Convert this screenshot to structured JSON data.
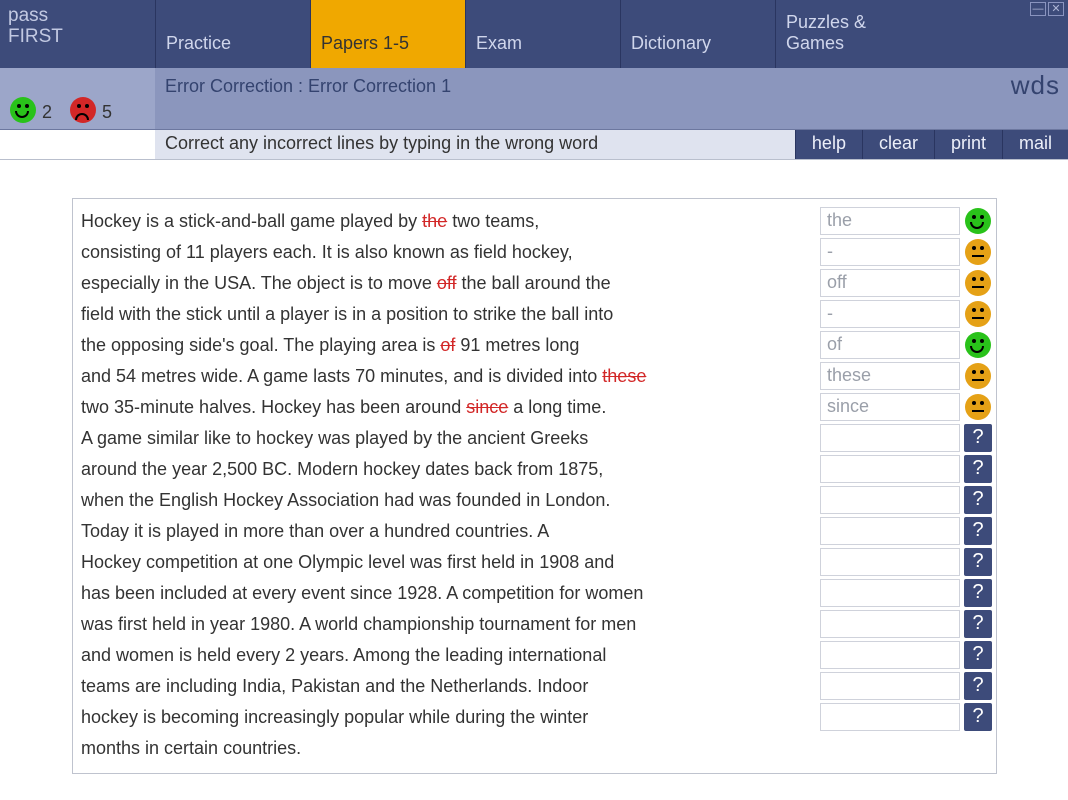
{
  "logo": {
    "line1": "pass",
    "line2": "FIRST"
  },
  "nav": {
    "tabs": [
      {
        "label": "Practice",
        "active": false
      },
      {
        "label": "Papers 1-5",
        "active": true
      },
      {
        "label": "Exam",
        "active": false
      },
      {
        "label": "Dictionary",
        "active": false
      },
      {
        "label": "Puzzles & Games",
        "active": false
      }
    ]
  },
  "brand": "wds",
  "subtitle": "Error Correction : Error Correction 1",
  "score": {
    "correct": "2",
    "incorrect": "5"
  },
  "instruction": "Correct any incorrect lines by typing in the wrong word",
  "actions": {
    "help": "help",
    "clear": "clear",
    "print": "print",
    "mail": "mail"
  },
  "lines": [
    {
      "pre": "Hockey is a stick-and-ball game played by ",
      "strike": "the",
      "post": " two teams,",
      "answer": "the",
      "status": "correct"
    },
    {
      "pre": "consisting of 11 players each. It is also known as field hockey,",
      "strike": "",
      "post": "",
      "answer": "-",
      "status": "neutral"
    },
    {
      "pre": "especially in the USA. The object is to move ",
      "strike": "off",
      "post": " the ball around the",
      "answer": "off",
      "status": "neutral"
    },
    {
      "pre": "field with the stick until a player is in a position to strike the ball into",
      "strike": "",
      "post": "",
      "answer": "-",
      "status": "neutral"
    },
    {
      "pre": "the opposing side's goal. The playing area is ",
      "strike": "of",
      "post": " 91 metres long",
      "answer": "of",
      "status": "correct"
    },
    {
      "pre": "and 54 metres wide. A game lasts 70 minutes, and is divided into ",
      "strike": "these",
      "post": "",
      "answer": "these",
      "status": "neutral"
    },
    {
      "pre": "two 35-minute halves. Hockey has been around ",
      "strike": "since",
      "post": " a long time.",
      "answer": "since",
      "status": "neutral"
    },
    {
      "pre": "A game similar like to hockey was played by the ancient Greeks",
      "strike": "",
      "post": "",
      "answer": "",
      "status": "pending",
      "focus": true
    },
    {
      "pre": "around the year 2,500 BC. Modern hockey dates back from 1875,",
      "strike": "",
      "post": "",
      "answer": "",
      "status": "pending"
    },
    {
      "pre": "when the English Hockey Association had was founded in London.",
      "strike": "",
      "post": "",
      "answer": "",
      "status": "pending"
    },
    {
      "pre": "Today it is played in more than over a hundred countries. A",
      "strike": "",
      "post": "",
      "answer": "",
      "status": "pending"
    },
    {
      "pre": "Hockey competition at one Olympic level was first held in 1908 and",
      "strike": "",
      "post": "",
      "answer": "",
      "status": "pending"
    },
    {
      "pre": "has been included at every event since 1928. A competition for women",
      "strike": "",
      "post": "",
      "answer": "",
      "status": "pending"
    },
    {
      "pre": "was first held in year 1980. A world championship tournament for men",
      "strike": "",
      "post": "",
      "answer": "",
      "status": "pending"
    },
    {
      "pre": "and women is held every 2 years. Among the leading international",
      "strike": "",
      "post": "",
      "answer": "",
      "status": "pending"
    },
    {
      "pre": "teams are including India, Pakistan and the Netherlands. Indoor",
      "strike": "",
      "post": "",
      "answer": "",
      "status": "pending"
    },
    {
      "pre": "hockey is becoming increasingly popular while during the winter",
      "strike": "",
      "post": "",
      "answer": "",
      "status": "pending"
    },
    {
      "pre": "months in certain countries.",
      "strike": "",
      "post": "",
      "answer": "",
      "status": "none"
    }
  ]
}
